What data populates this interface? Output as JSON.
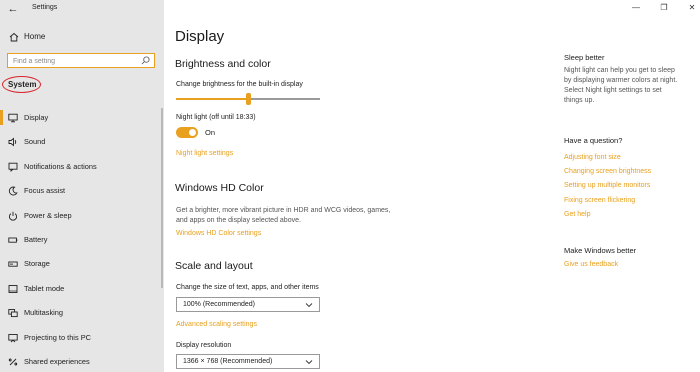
{
  "window": {
    "title": "Settings"
  },
  "sidebar": {
    "home_label": "Home",
    "search_placeholder": "Find a setting",
    "section_header": "System",
    "items": [
      {
        "label": "Display",
        "icon": "monitor-icon",
        "active": true
      },
      {
        "label": "Sound",
        "icon": "speaker-icon"
      },
      {
        "label": "Notifications & actions",
        "icon": "notification-icon"
      },
      {
        "label": "Focus assist",
        "icon": "moon-icon"
      },
      {
        "label": "Power & sleep",
        "icon": "power-icon"
      },
      {
        "label": "Battery",
        "icon": "battery-icon"
      },
      {
        "label": "Storage",
        "icon": "storage-icon"
      },
      {
        "label": "Tablet mode",
        "icon": "tablet-icon"
      },
      {
        "label": "Multitasking",
        "icon": "multitasking-icon"
      },
      {
        "label": "Projecting to this PC",
        "icon": "projecting-icon"
      },
      {
        "label": "Shared experiences",
        "icon": "shared-icon"
      }
    ]
  },
  "main": {
    "title": "Display",
    "brightness": {
      "heading": "Brightness and color",
      "slider_label": "Change brightness for the built-in display",
      "brightness_level": 0.5,
      "night_light_label": "Night light (off until 18:33)",
      "toggle_state": "On",
      "night_light_link": "Night light settings"
    },
    "hdr": {
      "heading": "Windows HD Color",
      "desc": "Get a brighter, more vibrant picture in HDR and WCG videos, games, and apps on the display selected above.",
      "link": "Windows HD Color settings"
    },
    "scale": {
      "heading": "Scale and layout",
      "size_label": "Change the size of text, apps, and other items",
      "size_value": "100% (Recommended)",
      "advanced_link": "Advanced scaling settings",
      "resolution_label": "Display resolution",
      "resolution_value": "1366 × 768 (Recommended)"
    }
  },
  "right": {
    "sleep_title": "Sleep better",
    "sleep_desc": "Night light can help you get to sleep by displaying warmer colors at night. Select Night light settings to set things up.",
    "question_title": "Have a question?",
    "links": [
      "Adjusting font size",
      "Changing screen brightness",
      "Setting up multiple monitors",
      "Fixing screen flickering",
      "Get help"
    ],
    "better_title": "Make Windows better",
    "feedback_link": "Give us feedback"
  },
  "colors": {
    "accent": "#e8a01e",
    "highlight": "#d8262c",
    "sidebar_bg": "#e6e6e6"
  }
}
